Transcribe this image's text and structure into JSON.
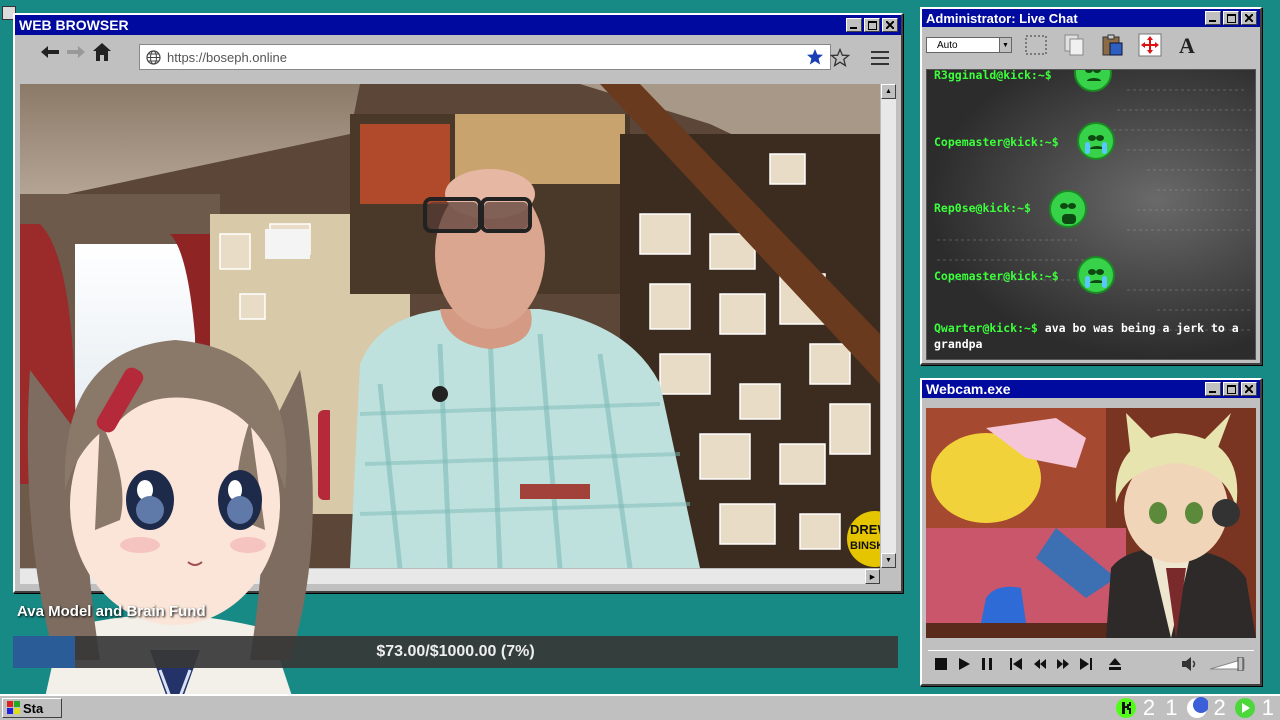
{
  "browser": {
    "title": "WEB BROWSER",
    "url": "https://boseph.online"
  },
  "chat": {
    "title": "Administrator: Live Chat",
    "size_select": "Auto",
    "messages": [
      {
        "user": "R3gginald@kick:~$",
        "text": "",
        "emote": "pepe-sad-icon"
      },
      {
        "user": "Copemaster@kick:~$",
        "text": "",
        "emote": "pepe-crying-icon"
      },
      {
        "user": "Rep0se@kick:~$",
        "text": "",
        "emote": "pepe-distressed-icon"
      },
      {
        "user": "Copemaster@kick:~$",
        "text": "",
        "emote": "pepe-crying-icon"
      },
      {
        "user": "Qwarter@kick:~$",
        "text": "ava bo was being a jerk to a grandpa",
        "emote": ""
      }
    ]
  },
  "webcam": {
    "title": "Webcam.exe"
  },
  "fund": {
    "title": "Ava Model and Brain Fund",
    "progress_text": "$73.00/$1000.00 (7%)",
    "raised": 73.0,
    "goal": 1000.0,
    "percent": 7
  },
  "stream_sign": "DREW BINSKY",
  "taskbar": {
    "start_label": "Sta",
    "tray_kick_count": "2 1",
    "tray_moon_count": "2",
    "tray_play_count": "1"
  },
  "colors": {
    "desktop": "#178a86",
    "titlebar": "#000a9e",
    "chat_user": "#3cff3c",
    "fund_fill": "#2a5d98"
  }
}
